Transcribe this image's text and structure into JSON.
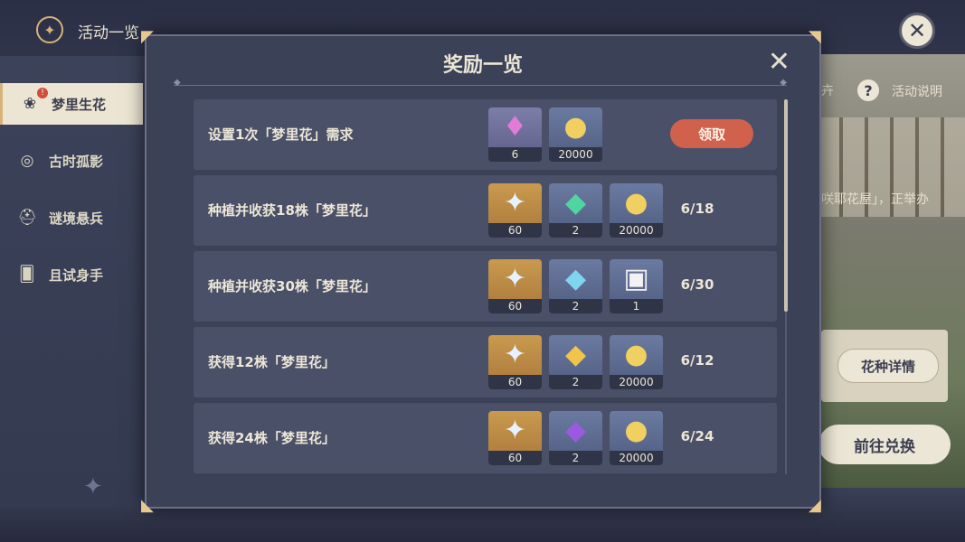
{
  "header": {
    "title": "活动一览"
  },
  "sidebar": {
    "items": [
      {
        "label": "梦里生花",
        "active": true,
        "badge": "!"
      },
      {
        "label": "古时孤影"
      },
      {
        "label": "谜境悬兵"
      },
      {
        "label": "且试身手"
      }
    ]
  },
  "background_panel": {
    "help_label": "活动说明",
    "partial_text_1": "卉",
    "partial_text_2": "咲耶花屋」，正举办",
    "flower_details_button": "花种详情",
    "exchange_button": "前往兑换"
  },
  "modal": {
    "title": "奖励一览",
    "rows": [
      {
        "task": "设置1次「梦里花」需求",
        "rewards": [
          {
            "icon": "crystal-icon",
            "count": "6"
          },
          {
            "icon": "mora-coin-icon",
            "count": "20000"
          }
        ],
        "action_label": "领取"
      },
      {
        "task": "种植并收获18株「梦里花」",
        "rewards": [
          {
            "icon": "hero-wit-icon",
            "count": "60"
          },
          {
            "icon": "green-gem-icon",
            "count": "2"
          },
          {
            "icon": "mora-coin-icon",
            "count": "20000"
          }
        ],
        "progress": "6/18"
      },
      {
        "task": "种植并收获30株「梦里花」",
        "rewards": [
          {
            "icon": "hero-wit-icon",
            "count": "60"
          },
          {
            "icon": "cyan-gem-icon",
            "count": "2"
          },
          {
            "icon": "gift-box-icon",
            "count": "1"
          }
        ],
        "progress": "6/30"
      },
      {
        "task": "获得12株「梦里花」",
        "rewards": [
          {
            "icon": "hero-wit-icon",
            "count": "60"
          },
          {
            "icon": "gold-gem-icon",
            "count": "2"
          },
          {
            "icon": "mora-coin-icon",
            "count": "20000"
          }
        ],
        "progress": "6/12"
      },
      {
        "task": "获得24株「梦里花」",
        "rewards": [
          {
            "icon": "hero-wit-icon",
            "count": "60"
          },
          {
            "icon": "violet-gem-icon",
            "count": "2"
          },
          {
            "icon": "mora-coin-icon",
            "count": "20000"
          }
        ],
        "progress": "6/24"
      }
    ]
  },
  "colors": {
    "accent_gold": "#d7b37a",
    "claim_button": "#d0614d",
    "panel_bg": "#3b4157"
  }
}
